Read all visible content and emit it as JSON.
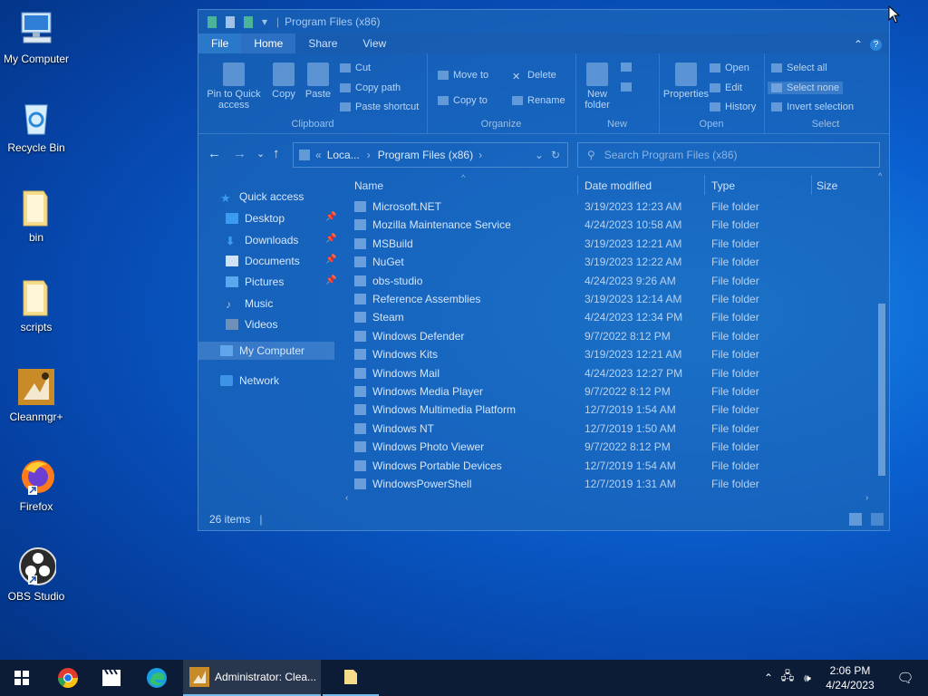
{
  "desktop": {
    "icons": [
      {
        "label": "My Computer",
        "icon": "computer-icon"
      },
      {
        "label": "Recycle Bin",
        "icon": "recycle-bin-icon"
      },
      {
        "label": "bin",
        "icon": "folder-icon"
      },
      {
        "label": "scripts",
        "icon": "folder-icon"
      },
      {
        "label": "Cleanmgr+",
        "icon": "cleanmgr-icon"
      },
      {
        "label": "Firefox",
        "icon": "firefox-icon"
      },
      {
        "label": "OBS Studio",
        "icon": "obs-icon"
      }
    ]
  },
  "window": {
    "title": "Program Files (x86)",
    "tabs": [
      "File",
      "Home",
      "Share",
      "View"
    ],
    "ribbon": {
      "clipboard": {
        "label": "Clipboard",
        "pin": "Pin to Quick access",
        "copy": "Copy",
        "paste": "Paste",
        "cut": "Cut",
        "copy_path": "Copy path",
        "paste_shortcut": "Paste shortcut"
      },
      "organize": {
        "label": "Organize",
        "move_to": "Move to",
        "copy_to": "Copy to",
        "delete": "Delete",
        "rename": "Rename"
      },
      "new": {
        "label": "New",
        "new_folder": "New folder"
      },
      "open": {
        "label": "Open",
        "properties": "Properties",
        "open": "Open",
        "edit": "Edit",
        "history": "History"
      },
      "select": {
        "label": "Select",
        "select_all": "Select all",
        "select_none": "Select none",
        "invert": "Invert selection"
      }
    },
    "address": {
      "crumb1": "Loca...",
      "crumb2": "Program Files (x86)"
    },
    "search_placeholder": "Search Program Files (x86)",
    "nav": {
      "quick_access": "Quick access",
      "items": [
        "Desktop",
        "Downloads",
        "Documents",
        "Pictures",
        "Music",
        "Videos"
      ],
      "my_computer": "My Computer",
      "network": "Network"
    },
    "columns": {
      "name": "Name",
      "date": "Date modified",
      "type": "Type",
      "size": "Size"
    },
    "files": [
      {
        "name": "Microsoft.NET",
        "date": "3/19/2023 12:23 AM",
        "type": "File folder"
      },
      {
        "name": "Mozilla Maintenance Service",
        "date": "4/24/2023 10:58 AM",
        "type": "File folder"
      },
      {
        "name": "MSBuild",
        "date": "3/19/2023 12:21 AM",
        "type": "File folder"
      },
      {
        "name": "NuGet",
        "date": "3/19/2023 12:22 AM",
        "type": "File folder"
      },
      {
        "name": "obs-studio",
        "date": "4/24/2023 9:26 AM",
        "type": "File folder"
      },
      {
        "name": "Reference Assemblies",
        "date": "3/19/2023 12:14 AM",
        "type": "File folder"
      },
      {
        "name": "Steam",
        "date": "4/24/2023 12:34 PM",
        "type": "File folder"
      },
      {
        "name": "Windows Defender",
        "date": "9/7/2022 8:12 PM",
        "type": "File folder"
      },
      {
        "name": "Windows Kits",
        "date": "3/19/2023 12:21 AM",
        "type": "File folder"
      },
      {
        "name": "Windows Mail",
        "date": "4/24/2023 12:27 PM",
        "type": "File folder"
      },
      {
        "name": "Windows Media Player",
        "date": "9/7/2022 8:12 PM",
        "type": "File folder"
      },
      {
        "name": "Windows Multimedia Platform",
        "date": "12/7/2019 1:54 AM",
        "type": "File folder"
      },
      {
        "name": "Windows NT",
        "date": "12/7/2019 1:50 AM",
        "type": "File folder"
      },
      {
        "name": "Windows Photo Viewer",
        "date": "9/7/2022 8:12 PM",
        "type": "File folder"
      },
      {
        "name": "Windows Portable Devices",
        "date": "12/7/2019 1:54 AM",
        "type": "File folder"
      },
      {
        "name": "WindowsPowerShell",
        "date": "12/7/2019 1:31 AM",
        "type": "File folder"
      }
    ],
    "status": "26 items"
  },
  "taskbar": {
    "active_app": "Administrator: Clea...",
    "time": "2:06 PM",
    "date": "4/24/2023"
  }
}
